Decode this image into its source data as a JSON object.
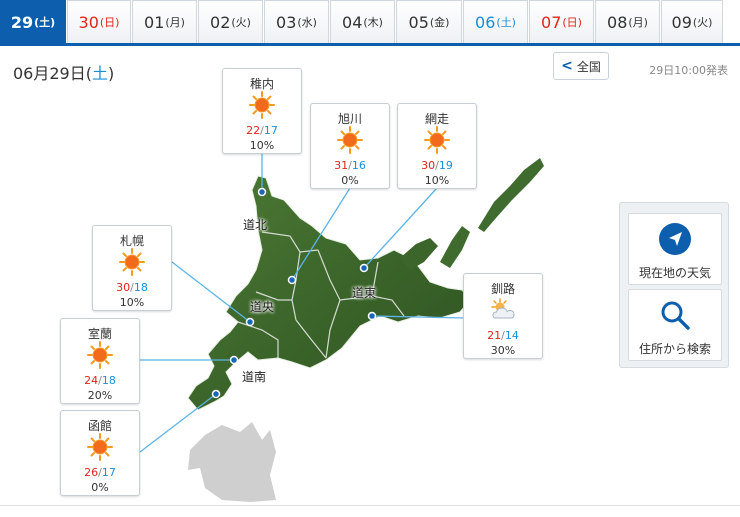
{
  "tabs": [
    {
      "day": "29",
      "dow": "(土)",
      "kind": "active"
    },
    {
      "day": "30",
      "dow": "(日)",
      "kind": "sun"
    },
    {
      "day": "01",
      "dow": "(月)",
      "kind": "normal"
    },
    {
      "day": "02",
      "dow": "(火)",
      "kind": "normal"
    },
    {
      "day": "03",
      "dow": "(水)",
      "kind": "normal"
    },
    {
      "day": "04",
      "dow": "(木)",
      "kind": "normal"
    },
    {
      "day": "05",
      "dow": "(金)",
      "kind": "normal"
    },
    {
      "day": "06",
      "dow": "(土)",
      "kind": "sat"
    },
    {
      "day": "07",
      "dow": "(日)",
      "kind": "sun"
    },
    {
      "day": "08",
      "dow": "(月)",
      "kind": "normal"
    },
    {
      "day": "09",
      "dow": "(火)",
      "kind": "normal"
    }
  ],
  "header": {
    "date_prefix": "06月29日(",
    "date_dow": "土",
    "date_suffix": ")",
    "back_label": "全国",
    "announce": "29日10:00発表"
  },
  "regions": {
    "dohoku": "道北",
    "doo": "道央",
    "doto": "道東",
    "donan": "道南"
  },
  "cities": [
    {
      "name": "稚内",
      "weather": "sunny",
      "high": "22",
      "low": "17",
      "pop": "10%"
    },
    {
      "name": "旭川",
      "weather": "sunny",
      "high": "31",
      "low": "16",
      "pop": "0%"
    },
    {
      "name": "網走",
      "weather": "sunny",
      "high": "30",
      "low": "19",
      "pop": "10%"
    },
    {
      "name": "札幌",
      "weather": "sunny",
      "high": "30",
      "low": "18",
      "pop": "10%"
    },
    {
      "name": "釧路",
      "weather": "cloudy",
      "high": "21",
      "low": "14",
      "pop": "30%"
    },
    {
      "name": "室蘭",
      "weather": "sunny",
      "high": "24",
      "low": "18",
      "pop": "20%"
    },
    {
      "name": "函館",
      "weather": "sunny",
      "high": "26",
      "low": "17",
      "pop": "0%"
    }
  ],
  "side": {
    "location_label": "現在地の天気",
    "search_label": "住所から検索"
  },
  "colors": {
    "accent": "#0d5fad",
    "high_temp": "#e0261b",
    "low_temp": "#1a8ed8",
    "map_green": "#3f6b2e",
    "connector": "#5bb4e6"
  }
}
